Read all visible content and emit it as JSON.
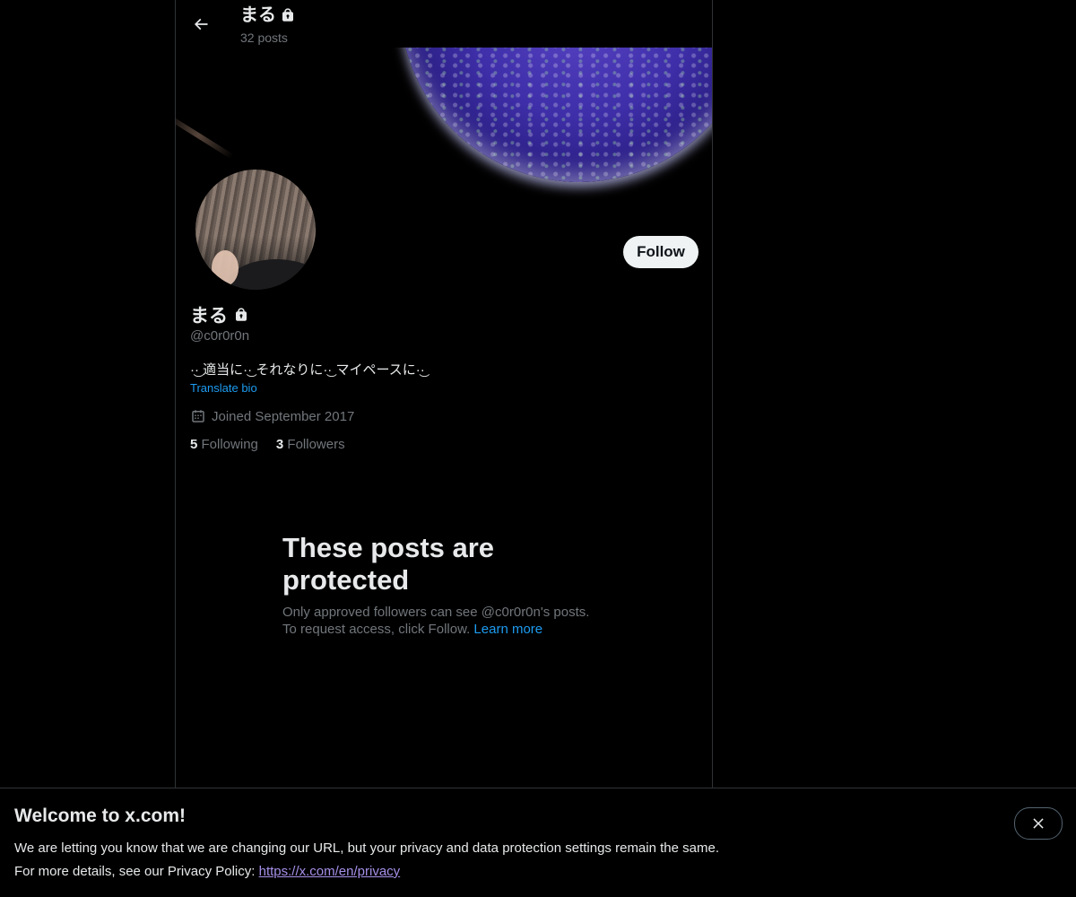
{
  "header": {
    "title": "まる",
    "posts_count": "32 posts",
    "back_icon": "arrow-left-icon",
    "lock_icon": "lock-icon"
  },
  "profile": {
    "name": "まる",
    "handle": "@c0r0r0n",
    "bio": "·͜· 適当に·͜· それなりに·͜· マイペースに·͜·",
    "translate_label": "Translate bio",
    "joined": "Joined September 2017",
    "following_count": "5",
    "following_label": "Following",
    "followers_count": "3",
    "followers_label": "Followers",
    "follow_label": "Follow"
  },
  "protected": {
    "title": "These posts are protected",
    "line1": "Only approved followers can see @c0r0r0n's posts.",
    "line2": "To request access, click Follow.",
    "learn_more": "Learn more"
  },
  "notice": {
    "title": "Welcome to x.com!",
    "line1": "We are letting you know that we are changing our URL, but your privacy and data protection settings remain the same.",
    "line2": "For more details, see our Privacy Policy:",
    "url": "https://x.com/en/privacy",
    "close_icon": "close-icon"
  },
  "colors": {
    "background": "#000000",
    "text": "#e7e9ea",
    "secondary": "#71767b",
    "accent": "#1d9bf0",
    "follow_bg": "#eff3f4"
  }
}
